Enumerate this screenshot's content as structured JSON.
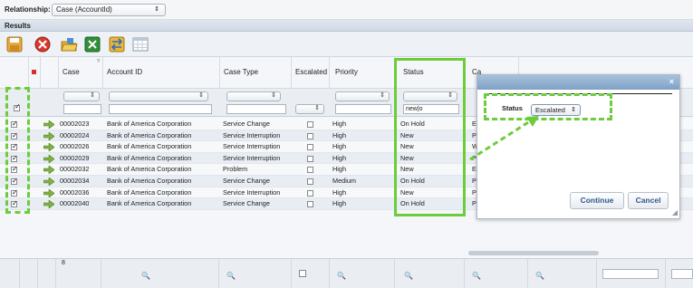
{
  "relationship": {
    "label": "Relationship:",
    "value": "Case (AccountId)"
  },
  "results": {
    "label": "Results"
  },
  "columns": {
    "sort_indicator": "▿",
    "case_number": "Case Number",
    "account_id": "Account ID",
    "case_type": "Case Type",
    "escalated": "Escalated",
    "priority": "Priority",
    "status": "Status",
    "cut_off": "Ca"
  },
  "filters": {
    "status_text": "new|o"
  },
  "rows": [
    {
      "case_number": "00002023",
      "account": "Bank of America Corporation",
      "case_type": "Service Change",
      "priority": "High",
      "status": "On Hold",
      "next": "Em"
    },
    {
      "case_number": "00002024",
      "account": "Bank of America Corporation",
      "case_type": "Service Interruption",
      "priority": "High",
      "status": "New",
      "next": "Pho"
    },
    {
      "case_number": "00002026",
      "account": "Bank of America Corporation",
      "case_type": "Service Interruption",
      "priority": "High",
      "status": "New",
      "next": "We"
    },
    {
      "case_number": "00002029",
      "account": "Bank of America Corporation",
      "case_type": "Service Interruption",
      "priority": "High",
      "status": "New",
      "next": "Pho"
    },
    {
      "case_number": "00002032",
      "account": "Bank of America Corporation",
      "case_type": "Problem",
      "priority": "High",
      "status": "New",
      "next": "Em"
    },
    {
      "case_number": "00002034",
      "account": "Bank of America Corporation",
      "case_type": "Service Change",
      "priority": "Medium",
      "status": "On Hold",
      "next": "Pho"
    },
    {
      "case_number": "00002036",
      "account": "Bank of America Corporation",
      "case_type": "Service Interruption",
      "priority": "High",
      "status": "New",
      "next": "Pho"
    },
    {
      "case_number": "00002040",
      "account": "Bank of America Corporation",
      "case_type": "Service Change",
      "priority": "High",
      "status": "On Hold",
      "next": "Pho"
    }
  ],
  "footer": {
    "count_label": "8"
  },
  "dialog": {
    "close": "×",
    "status_label": "Status",
    "status_value": "Escalated",
    "continue": "Continue",
    "cancel": "Cancel"
  },
  "colors": {
    "highlight": "#6ccc3c",
    "dialog_title": "#7fa1c6",
    "button_text": "#2f5a8a"
  },
  "icons": [
    "save-icon",
    "delete-icon",
    "open-folder-icon",
    "excel-icon",
    "exchange-icon",
    "table-icon",
    "row-arrow-icon",
    "magnifier-icon",
    "red-square-icon"
  ]
}
